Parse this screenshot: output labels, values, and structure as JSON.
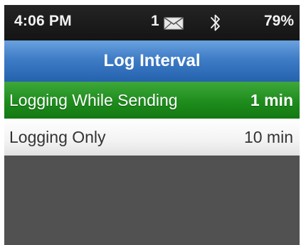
{
  "status_bar": {
    "time": "4:06 PM",
    "message_count": "1",
    "battery": "79%"
  },
  "title_bar": {
    "title": "Log Interval"
  },
  "menu": {
    "items": [
      {
        "label": "Logging While Sending",
        "value": "1 min",
        "selected": true
      },
      {
        "label": "Logging Only",
        "value": "10 min",
        "selected": false
      }
    ]
  },
  "icons": {
    "mail": "mail-icon",
    "bluetooth": "bluetooth-icon"
  },
  "colors": {
    "status_bar": "#1c1c1c",
    "title_bar": "#3f7cc6",
    "selected_item": "#1e8c1d",
    "item_background": "#f3f3f3",
    "screen_background": "#515151"
  }
}
